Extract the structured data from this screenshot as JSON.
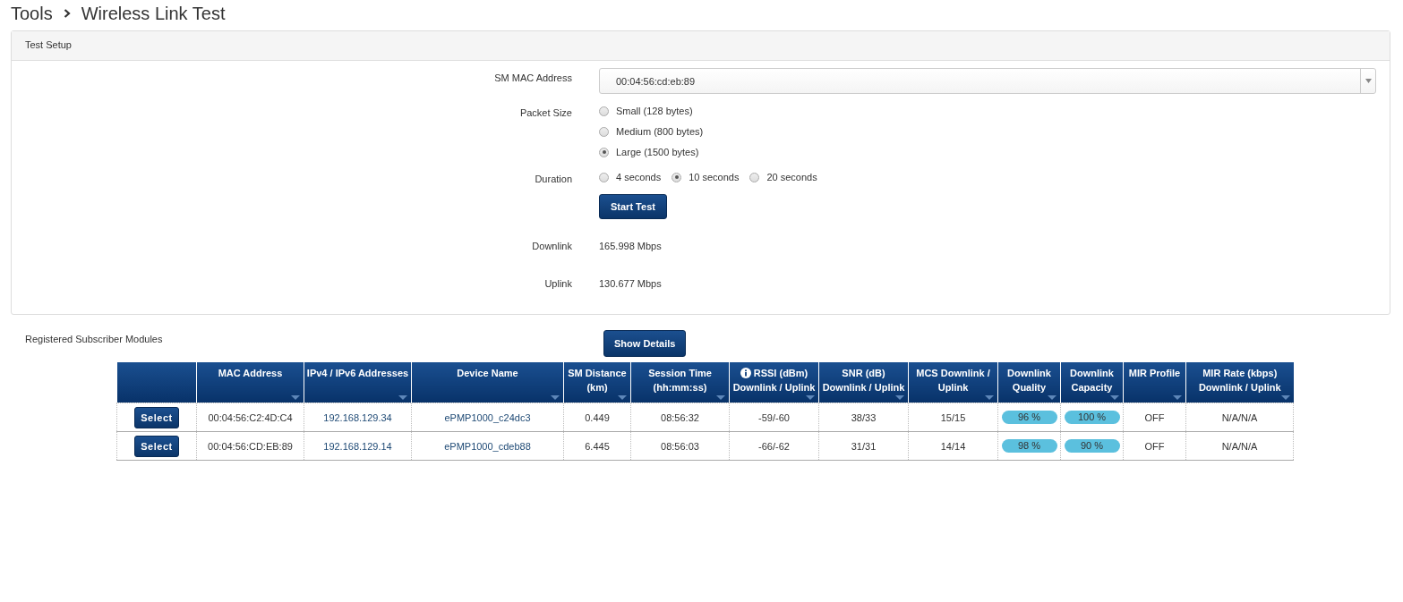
{
  "breadcrumb": [
    "Tools",
    "Wireless Link Test"
  ],
  "test_setup": {
    "title": "Test Setup",
    "sm_mac": {
      "label": "SM MAC Address",
      "value": "00:04:56:cd:eb:89"
    },
    "packet_size": {
      "label": "Packet Size",
      "options": [
        {
          "label": "Small (128 bytes)",
          "selected": false
        },
        {
          "label": "Medium (800 bytes)",
          "selected": false
        },
        {
          "label": "Large (1500 bytes)",
          "selected": true
        }
      ]
    },
    "duration": {
      "label": "Duration",
      "options": [
        {
          "label": "4 seconds",
          "selected": false
        },
        {
          "label": "10 seconds",
          "selected": true
        },
        {
          "label": "20 seconds",
          "selected": false
        }
      ]
    },
    "start_button": "Start Test",
    "results": [
      {
        "label": "Downlink",
        "value": "165.998 Mbps"
      },
      {
        "label": "Uplink",
        "value": "130.677 Mbps"
      }
    ]
  },
  "registered": {
    "title": "Registered Subscriber Modules",
    "show_details_button": "Show Details",
    "columns": [
      {},
      {
        "label": "MAC Address"
      },
      {
        "label": "IPv4 / IPv6 Addresses"
      },
      {
        "label": "Device Name"
      },
      {
        "label": "SM Distance (km)"
      },
      {
        "label": "Session Time (hh:mm:ss)"
      },
      {
        "label": "RSSI (dBm) Downlink / Uplink",
        "info": true
      },
      {
        "label": "SNR (dB) Downlink / Uplink"
      },
      {
        "label": "MCS Downlink / Uplink"
      },
      {
        "label": "Downlink Quality"
      },
      {
        "label": "Downlink Capacity"
      },
      {
        "label": "MIR Profile"
      },
      {
        "label": "MIR Rate (kbps) Downlink / Uplink"
      }
    ],
    "rows": [
      {
        "select": "Select",
        "mac": "00:04:56:C2:4D:C4",
        "ip": "192.168.129.34",
        "device": "ePMP1000_c24dc3",
        "distance": "0.449",
        "session": "08:56:32",
        "rssi": "-59/-60",
        "snr": "38/33",
        "mcs": "15/15",
        "quality": "96 %",
        "capacity": "100 %",
        "mir_profile": "OFF",
        "mir_rate": "N/A/N/A"
      },
      {
        "select": "Select",
        "mac": "00:04:56:CD:EB:89",
        "ip": "192.168.129.14",
        "device": "ePMP1000_cdeb88",
        "distance": "6.445",
        "session": "08:56:03",
        "rssi": "-66/-62",
        "snr": "31/31",
        "mcs": "14/14",
        "quality": "98 %",
        "capacity": "90 %",
        "mir_profile": "OFF",
        "mir_rate": "N/A/N/A"
      }
    ]
  }
}
